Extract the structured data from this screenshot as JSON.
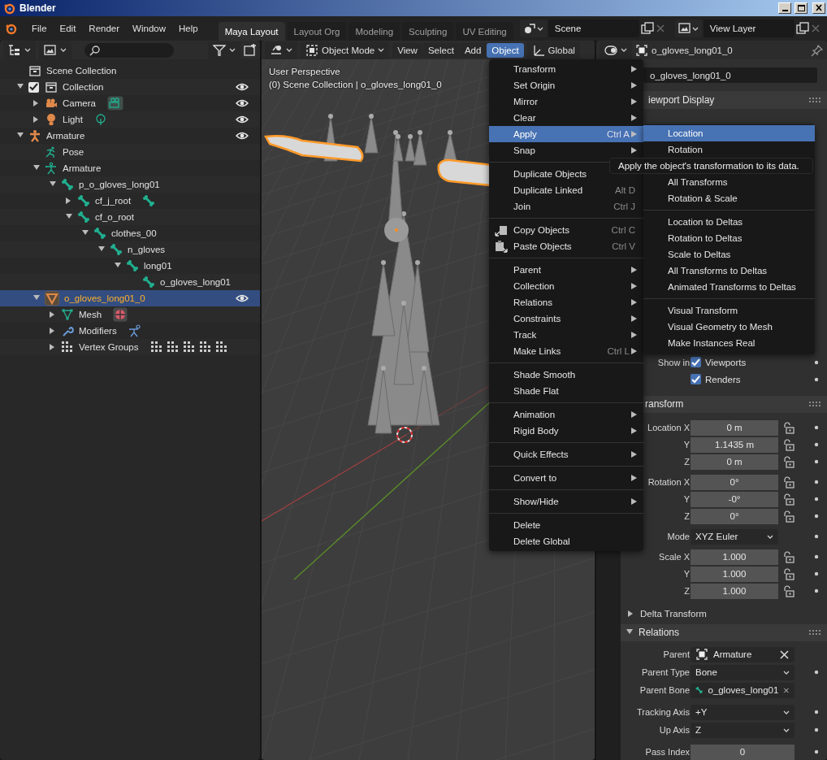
{
  "window": {
    "title": "Blender"
  },
  "menu_bar": [
    "File",
    "Edit",
    "Render",
    "Window",
    "Help"
  ],
  "workspaces": [
    {
      "label": "Maya Layout",
      "selected": true
    },
    {
      "label": "Layout Org",
      "selected": false
    },
    {
      "label": "Modeling",
      "selected": false
    },
    {
      "label": "Sculpting",
      "selected": false
    },
    {
      "label": "UV Editing",
      "selected": false
    }
  ],
  "scene": {
    "value": "Scene"
  },
  "view_layer": {
    "value": "View Layer"
  },
  "outliner": {
    "tree": [
      {
        "name": "Scene Collection",
        "kind": "scene-collection",
        "selected": false,
        "eye": false,
        "children": [
          {
            "name": "Collection",
            "kind": "collection",
            "expanded": true,
            "checked": true,
            "eye": true,
            "selected": false,
            "children": [
              {
                "name": "Camera",
                "kind": "camera",
                "expanded": false,
                "eye": true,
                "selected": false
              },
              {
                "name": "Light",
                "kind": "light",
                "expanded": false,
                "eye": true,
                "selected": false
              }
            ]
          },
          {
            "name": "Armature",
            "kind": "armature",
            "expanded": true,
            "eye": true,
            "selected": false,
            "children": [
              {
                "name": "Pose",
                "kind": "pose",
                "eye": false,
                "selected": false
              },
              {
                "name": "Armature",
                "kind": "armature-data",
                "expanded": true,
                "eye": false,
                "selected": false,
                "children": [
                  {
                    "name": "p_o_gloves_long01",
                    "kind": "bone",
                    "expanded": true,
                    "eye": false,
                    "selected": false,
                    "children": [
                      {
                        "name": "cf_j_root",
                        "kind": "bone",
                        "expanded": false,
                        "eye": false,
                        "selected": false
                      },
                      {
                        "name": "cf_o_root",
                        "kind": "bone",
                        "expanded": true,
                        "eye": false,
                        "selected": false,
                        "children": [
                          {
                            "name": "clothes_00",
                            "kind": "bone",
                            "expanded": true,
                            "eye": false,
                            "selected": false,
                            "children": [
                              {
                                "name": "n_gloves",
                                "kind": "bone",
                                "expanded": true,
                                "eye": false,
                                "selected": false,
                                "children": [
                                  {
                                    "name": "long01",
                                    "kind": "bone",
                                    "expanded": true,
                                    "eye": false,
                                    "selected": false,
                                    "children": [
                                      {
                                        "name": "o_gloves_long01",
                                        "kind": "bone",
                                        "eye": false,
                                        "selected": false
                                      }
                                    ]
                                  }
                                ]
                              }
                            ]
                          }
                        ]
                      }
                    ]
                  }
                ]
              },
              {
                "name": "o_gloves_long01_0",
                "kind": "mesh-object",
                "expanded": true,
                "eye": true,
                "selected": true,
                "children": [
                  {
                    "name": "Mesh",
                    "kind": "mesh",
                    "expanded": false,
                    "eye": false,
                    "selected": false
                  },
                  {
                    "name": "Modifiers",
                    "kind": "modifiers",
                    "expanded": false,
                    "eye": false,
                    "selected": false
                  },
                  {
                    "name": "Vertex Groups",
                    "kind": "vertex-groups",
                    "expanded": false,
                    "eye": false,
                    "selected": false
                  }
                ]
              }
            ]
          }
        ]
      }
    ]
  },
  "viewport": {
    "mode": "Object Mode",
    "menus": [
      {
        "label": "View",
        "selected": false
      },
      {
        "label": "Select",
        "selected": false
      },
      {
        "label": "Add",
        "selected": false
      },
      {
        "label": "Object",
        "selected": true
      }
    ],
    "orientation": "Global",
    "overlay": [
      "User Perspective",
      "(0) Scene Collection | o_gloves_long01_0"
    ]
  },
  "object_menu": {
    "sections": [
      [
        {
          "label": "Transform",
          "kind": "submenu",
          "selected": false
        },
        {
          "label": "Set Origin",
          "kind": "submenu",
          "selected": false
        },
        {
          "label": "Mirror",
          "kind": "submenu",
          "selected": false
        },
        {
          "label": "Clear",
          "kind": "submenu",
          "selected": false
        },
        {
          "label": "Apply",
          "shortcut": "Ctrl A",
          "kind": "submenu",
          "selected": true
        },
        {
          "label": "Snap",
          "kind": "submenu",
          "selected": false
        }
      ],
      [
        {
          "label": "Duplicate Objects",
          "kind": "command",
          "selected": false
        },
        {
          "label": "Duplicate Linked",
          "shortcut": "Alt D",
          "kind": "command",
          "selected": false
        },
        {
          "label": "Join",
          "shortcut": "Ctrl J",
          "kind": "command",
          "selected": false
        }
      ],
      [
        {
          "label": "Copy Objects",
          "shortcut": "Ctrl C",
          "kind": "copy",
          "selected": false
        },
        {
          "label": "Paste Objects",
          "shortcut": "Ctrl V",
          "kind": "paste",
          "selected": false
        }
      ],
      [
        {
          "label": "Parent",
          "kind": "submenu",
          "selected": false
        },
        {
          "label": "Collection",
          "kind": "submenu",
          "selected": false
        },
        {
          "label": "Relations",
          "kind": "submenu",
          "selected": false
        },
        {
          "label": "Constraints",
          "kind": "submenu",
          "selected": false
        },
        {
          "label": "Track",
          "kind": "submenu",
          "selected": false
        },
        {
          "label": "Make Links",
          "shortcut": "Ctrl L",
          "kind": "submenu",
          "selected": false
        }
      ],
      [
        {
          "label": "Shade Smooth",
          "kind": "command",
          "selected": false
        },
        {
          "label": "Shade Flat",
          "kind": "command",
          "selected": false
        }
      ],
      [
        {
          "label": "Animation",
          "kind": "submenu",
          "selected": false
        },
        {
          "label": "Rigid Body",
          "kind": "submenu",
          "selected": false
        }
      ],
      [
        {
          "label": "Quick Effects",
          "kind": "submenu",
          "selected": false
        }
      ],
      [
        {
          "label": "Convert to",
          "kind": "submenu",
          "selected": false
        }
      ],
      [
        {
          "label": "Show/Hide",
          "kind": "submenu",
          "selected": false
        }
      ],
      [
        {
          "label": "Delete",
          "kind": "command",
          "selected": false
        },
        {
          "label": "Delete Global",
          "kind": "command",
          "selected": false
        }
      ]
    ]
  },
  "apply_submenu": {
    "sections": [
      [
        {
          "label": "Location",
          "kind": "command",
          "selected": true
        },
        {
          "label": "Rotation",
          "kind": "command",
          "selected": false
        },
        {
          "text": "Apply the object's transformation to its data.",
          "kind": "tooltip"
        },
        {
          "label": "All Transforms",
          "kind": "command",
          "selected": false
        },
        {
          "label": "Rotation & Scale",
          "kind": "command",
          "selected": false
        }
      ],
      [
        {
          "label": "Location to Deltas",
          "kind": "command",
          "selected": false
        },
        {
          "label": "Rotation to Deltas",
          "kind": "command",
          "selected": false
        },
        {
          "label": "Scale to Deltas",
          "kind": "command",
          "selected": false
        },
        {
          "label": "All Transforms to Deltas",
          "kind": "command",
          "selected": false
        },
        {
          "label": "Animated Transforms to Deltas",
          "kind": "command",
          "selected": false
        }
      ],
      [
        {
          "label": "Visual Transform",
          "kind": "command",
          "selected": false
        },
        {
          "label": "Visual Geometry to Mesh",
          "kind": "command",
          "selected": false
        },
        {
          "label": "Make Instances Real",
          "kind": "command",
          "selected": false
        }
      ]
    ]
  },
  "properties": {
    "object_name": "o_gloves_long01_0",
    "name_field": "o_gloves_long01_0",
    "viewport_display": {
      "title": "iewport Display"
    },
    "visibility": [
      {
        "label": "Show in",
        "option": "Viewports",
        "checked": true
      },
      {
        "option": "Renders",
        "checked": true
      }
    ],
    "transform": {
      "title": "ransform",
      "groups": [
        [
          {
            "label": "Location X",
            "value": "0 m",
            "kind": "transform"
          },
          {
            "label": "Y",
            "value": "1.1435 m",
            "kind": "transform"
          },
          {
            "label": "Z",
            "value": "0 m",
            "kind": "transform"
          }
        ],
        [
          {
            "label": "Rotation X",
            "value": "0°",
            "kind": "transform"
          },
          {
            "label": "Y",
            "value": "-0°",
            "kind": "transform"
          },
          {
            "label": "Z",
            "value": "0°",
            "kind": "transform"
          }
        ],
        [
          {
            "label": "Mode",
            "value": "XYZ Euler",
            "kind": "dropdown"
          }
        ],
        [
          {
            "label": "Scale X",
            "value": "1.000",
            "kind": "transform"
          },
          {
            "label": "Y",
            "value": "1.000",
            "kind": "transform"
          },
          {
            "label": "Z",
            "value": "1.000",
            "kind": "transform"
          }
        ]
      ]
    },
    "delta_transform": {
      "title": "Delta Transform",
      "expanded": false
    },
    "relations": {
      "title": "Relations",
      "expanded": true,
      "groups": [
        [
          {
            "label": "Parent",
            "value": "Armature",
            "kind": "object"
          },
          {
            "label": "Parent Type",
            "value": "Bone",
            "kind": "dropdown"
          },
          {
            "label": "Parent Bone",
            "value": "o_gloves_long01",
            "kind": "bone"
          }
        ],
        [
          {
            "label": "Tracking Axis",
            "value": "+Y",
            "kind": "dropdown"
          },
          {
            "label": "Up Axis",
            "value": "Z",
            "kind": "dropdown"
          }
        ],
        [
          {
            "label": "Pass Index",
            "value": "0",
            "kind": "number"
          }
        ]
      ]
    }
  }
}
